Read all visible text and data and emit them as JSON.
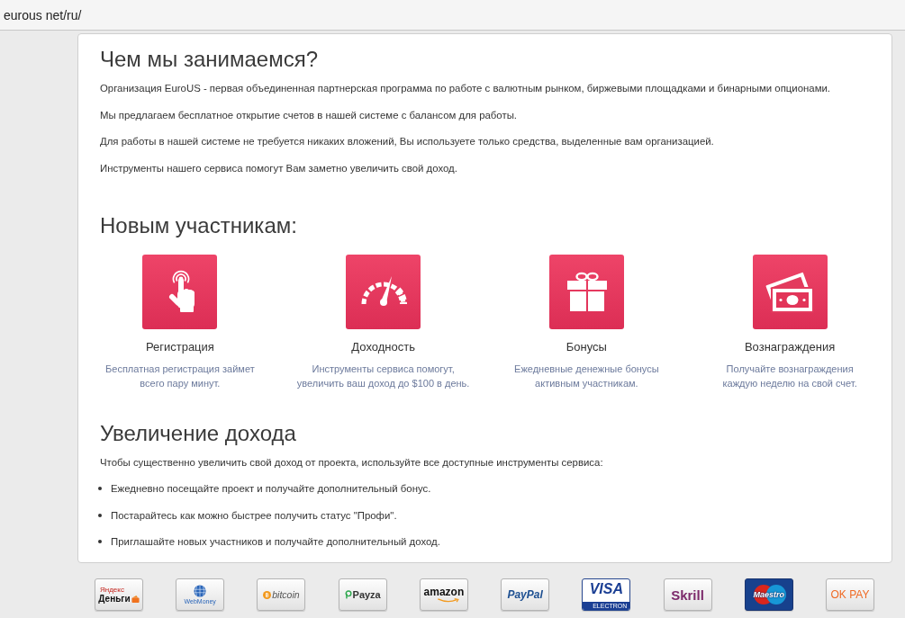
{
  "address_bar": {
    "url": "eurous net/ru/"
  },
  "about": {
    "heading": "Чем мы занимаемся?",
    "paragraphs": [
      "Организация EuroUS - первая объединенная партнерская программа по работе с валютным рынком, биржевыми площадками и бинарными опционами.",
      "Мы предлагаем бесплатное открытие счетов в нашей системе с балансом для работы.",
      "Для работы в нашей системе не требуется никаких вложений, Вы используете только средства, выделенные вам организацией.",
      "Инструменты нашего сервиса помогут Вам заметно увеличить свой доход."
    ]
  },
  "new_members": {
    "heading": "Новым участникам:",
    "features": [
      {
        "title": "Регистрация",
        "description": "Бесплатная регистрация займет\nвсего пару минут."
      },
      {
        "title": "Доходность",
        "description": "Инструменты сервиса помогут,\nувеличить ваш доход до $100 в день."
      },
      {
        "title": "Бонусы",
        "description": "Ежедневные денежные бонусы\nактивным участникам."
      },
      {
        "title": "Вознаграждения",
        "description": "Получайте вознаграждения\nкаждую неделю на свой счет."
      }
    ]
  },
  "income": {
    "heading": "Увеличение дохода",
    "intro": "Чтобы существенно увеличить свой доход от проекта, используйте все доступные инструменты сервиса:",
    "bullets": [
      "Ежедневно посещайте проект и получайте дополнительный бонус.",
      "Постарайтесь как можно быстрее получить статус \"Профи\".",
      "Приглашайте новых участников и получайте дополнительный доход."
    ]
  },
  "payment_logos": [
    {
      "kind": "yandex",
      "caption": "Яндекс",
      "text": "Деньги"
    },
    {
      "kind": "webmoney",
      "text": "WebMoney"
    },
    {
      "kind": "bitcoin",
      "text": "bitcoin"
    },
    {
      "kind": "payza",
      "text": "Payza"
    },
    {
      "kind": "amazon",
      "text": "amazon"
    },
    {
      "kind": "paypal",
      "text": "PayPal"
    },
    {
      "kind": "visa",
      "text": "VISA",
      "caption": "ELECTRON"
    },
    {
      "kind": "skrill",
      "text": "Skrill"
    },
    {
      "kind": "maestro",
      "text": "Maestro"
    },
    {
      "kind": "okpay",
      "text": "OK PAY"
    }
  ]
}
